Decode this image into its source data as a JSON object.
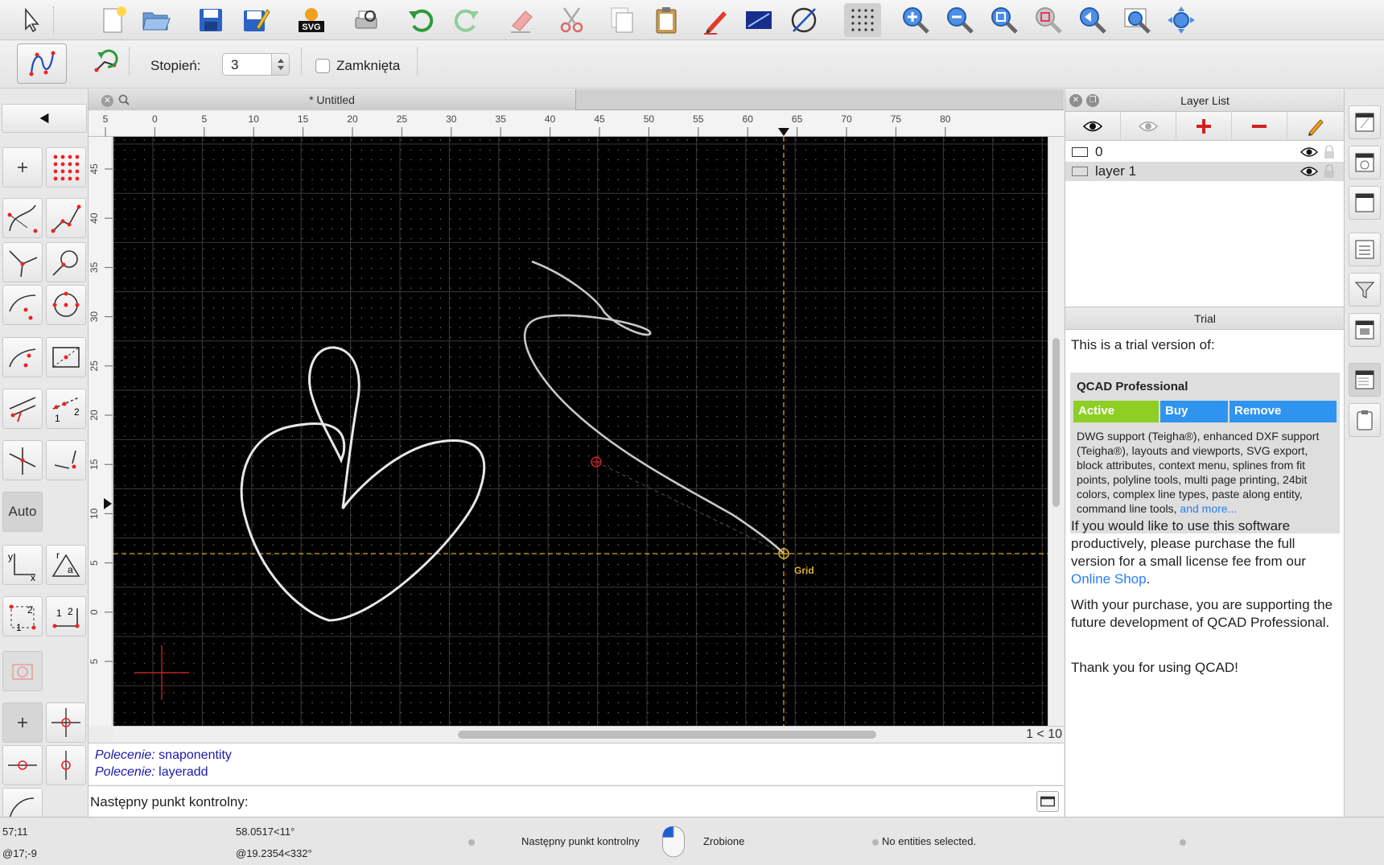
{
  "options_toolbar": {
    "degree_label": "Stopień:",
    "degree_value": "3",
    "closed_label": "Zamknięta"
  },
  "left_palette": {
    "auto_label": "Auto"
  },
  "document": {
    "tab_title": "* Untitled",
    "page_indicator": "1 < 10"
  },
  "rulers": {
    "top_labels": [
      "5",
      "0",
      "5",
      "10",
      "15",
      "20",
      "25",
      "30",
      "35",
      "40",
      "45",
      "50",
      "55",
      "60",
      "65",
      "70",
      "75",
      "80"
    ],
    "left_labels": [
      "45",
      "40",
      "35",
      "30",
      "25",
      "20",
      "15",
      "10",
      "5",
      "0",
      "5"
    ]
  },
  "canvas": {
    "snap_label": "Grid",
    "background": "#000000",
    "crosshair_color": "#e0a020"
  },
  "command": {
    "history": [
      {
        "keyword": "Polecenie:",
        "text": "snaponentity"
      },
      {
        "keyword": "Polecenie:",
        "text": "layeradd"
      }
    ],
    "prompt": "Następny punkt kontrolny:"
  },
  "status_bar": {
    "abs_coord": "57;11",
    "rel_coord": "@17;-9",
    "polar_abs": "58.0517<11°",
    "polar_rel": "@19.2354<332°",
    "mouse_left": "Następny punkt kontrolny",
    "mouse_right": "Zrobione",
    "selection": "No entities selected."
  },
  "layer_panel": {
    "title": "Layer List",
    "layers": [
      {
        "name": "0"
      },
      {
        "name": "layer 1"
      }
    ]
  },
  "trial_panel": {
    "title": "Trial",
    "intro": "This is a trial version of:",
    "product": "QCAD Professional",
    "btn_active": "Active",
    "btn_buy": "Buy",
    "btn_remove": "Remove",
    "features": "DWG support (Teigha®), enhanced DXF support (Teigha®), layouts and viewports, SVG export, block attributes, context menu, splines from fit points, polyline tools, multi page printing, 24bit colors, complex line types, paste along entity, command line tools,",
    "features_more": "and more...",
    "para1_pre": "If you would like to use this software productively, please purchase the full version for a small license fee from our",
    "para1_link": "Online Shop",
    "para1_post": ".",
    "para2": "With your purchase, you are supporting the future development of QCAD Professional.",
    "para3": "Thank you for using QCAD!"
  },
  "colors": {
    "accent_blue": "#2f94f0",
    "active_green": "#8fce25",
    "link": "#2a7ef0",
    "command_text": "#1a1aa8"
  }
}
